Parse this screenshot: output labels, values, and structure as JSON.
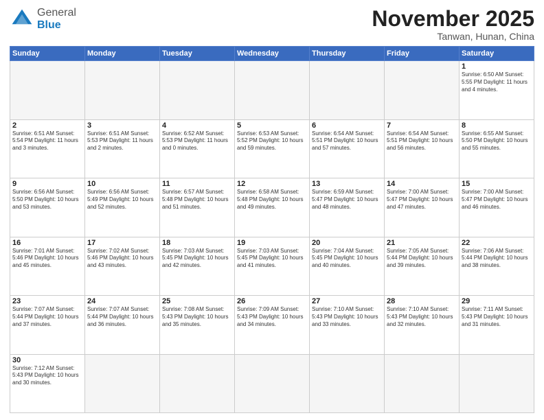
{
  "header": {
    "logo_general": "General",
    "logo_blue": "Blue",
    "month_title": "November 2025",
    "location": "Tanwan, Hunan, China"
  },
  "weekdays": [
    "Sunday",
    "Monday",
    "Tuesday",
    "Wednesday",
    "Thursday",
    "Friday",
    "Saturday"
  ],
  "days": [
    {
      "num": "",
      "info": ""
    },
    {
      "num": "",
      "info": ""
    },
    {
      "num": "",
      "info": ""
    },
    {
      "num": "",
      "info": ""
    },
    {
      "num": "",
      "info": ""
    },
    {
      "num": "",
      "info": ""
    },
    {
      "num": "1",
      "info": "Sunrise: 6:50 AM\nSunset: 5:55 PM\nDaylight: 11 hours\nand 4 minutes."
    },
    {
      "num": "2",
      "info": "Sunrise: 6:51 AM\nSunset: 5:54 PM\nDaylight: 11 hours\nand 3 minutes."
    },
    {
      "num": "3",
      "info": "Sunrise: 6:51 AM\nSunset: 5:53 PM\nDaylight: 11 hours\nand 2 minutes."
    },
    {
      "num": "4",
      "info": "Sunrise: 6:52 AM\nSunset: 5:53 PM\nDaylight: 11 hours\nand 0 minutes."
    },
    {
      "num": "5",
      "info": "Sunrise: 6:53 AM\nSunset: 5:52 PM\nDaylight: 10 hours\nand 59 minutes."
    },
    {
      "num": "6",
      "info": "Sunrise: 6:54 AM\nSunset: 5:51 PM\nDaylight: 10 hours\nand 57 minutes."
    },
    {
      "num": "7",
      "info": "Sunrise: 6:54 AM\nSunset: 5:51 PM\nDaylight: 10 hours\nand 56 minutes."
    },
    {
      "num": "8",
      "info": "Sunrise: 6:55 AM\nSunset: 5:50 PM\nDaylight: 10 hours\nand 55 minutes."
    },
    {
      "num": "9",
      "info": "Sunrise: 6:56 AM\nSunset: 5:50 PM\nDaylight: 10 hours\nand 53 minutes."
    },
    {
      "num": "10",
      "info": "Sunrise: 6:56 AM\nSunset: 5:49 PM\nDaylight: 10 hours\nand 52 minutes."
    },
    {
      "num": "11",
      "info": "Sunrise: 6:57 AM\nSunset: 5:48 PM\nDaylight: 10 hours\nand 51 minutes."
    },
    {
      "num": "12",
      "info": "Sunrise: 6:58 AM\nSunset: 5:48 PM\nDaylight: 10 hours\nand 49 minutes."
    },
    {
      "num": "13",
      "info": "Sunrise: 6:59 AM\nSunset: 5:47 PM\nDaylight: 10 hours\nand 48 minutes."
    },
    {
      "num": "14",
      "info": "Sunrise: 7:00 AM\nSunset: 5:47 PM\nDaylight: 10 hours\nand 47 minutes."
    },
    {
      "num": "15",
      "info": "Sunrise: 7:00 AM\nSunset: 5:47 PM\nDaylight: 10 hours\nand 46 minutes."
    },
    {
      "num": "16",
      "info": "Sunrise: 7:01 AM\nSunset: 5:46 PM\nDaylight: 10 hours\nand 45 minutes."
    },
    {
      "num": "17",
      "info": "Sunrise: 7:02 AM\nSunset: 5:46 PM\nDaylight: 10 hours\nand 43 minutes."
    },
    {
      "num": "18",
      "info": "Sunrise: 7:03 AM\nSunset: 5:45 PM\nDaylight: 10 hours\nand 42 minutes."
    },
    {
      "num": "19",
      "info": "Sunrise: 7:03 AM\nSunset: 5:45 PM\nDaylight: 10 hours\nand 41 minutes."
    },
    {
      "num": "20",
      "info": "Sunrise: 7:04 AM\nSunset: 5:45 PM\nDaylight: 10 hours\nand 40 minutes."
    },
    {
      "num": "21",
      "info": "Sunrise: 7:05 AM\nSunset: 5:44 PM\nDaylight: 10 hours\nand 39 minutes."
    },
    {
      "num": "22",
      "info": "Sunrise: 7:06 AM\nSunset: 5:44 PM\nDaylight: 10 hours\nand 38 minutes."
    },
    {
      "num": "23",
      "info": "Sunrise: 7:07 AM\nSunset: 5:44 PM\nDaylight: 10 hours\nand 37 minutes."
    },
    {
      "num": "24",
      "info": "Sunrise: 7:07 AM\nSunset: 5:44 PM\nDaylight: 10 hours\nand 36 minutes."
    },
    {
      "num": "25",
      "info": "Sunrise: 7:08 AM\nSunset: 5:43 PM\nDaylight: 10 hours\nand 35 minutes."
    },
    {
      "num": "26",
      "info": "Sunrise: 7:09 AM\nSunset: 5:43 PM\nDaylight: 10 hours\nand 34 minutes."
    },
    {
      "num": "27",
      "info": "Sunrise: 7:10 AM\nSunset: 5:43 PM\nDaylight: 10 hours\nand 33 minutes."
    },
    {
      "num": "28",
      "info": "Sunrise: 7:10 AM\nSunset: 5:43 PM\nDaylight: 10 hours\nand 32 minutes."
    },
    {
      "num": "29",
      "info": "Sunrise: 7:11 AM\nSunset: 5:43 PM\nDaylight: 10 hours\nand 31 minutes."
    },
    {
      "num": "30",
      "info": "Sunrise: 7:12 AM\nSunset: 5:43 PM\nDaylight: 10 hours\nand 30 minutes."
    },
    {
      "num": "",
      "info": ""
    },
    {
      "num": "",
      "info": ""
    },
    {
      "num": "",
      "info": ""
    },
    {
      "num": "",
      "info": ""
    },
    {
      "num": "",
      "info": ""
    },
    {
      "num": "",
      "info": ""
    }
  ]
}
